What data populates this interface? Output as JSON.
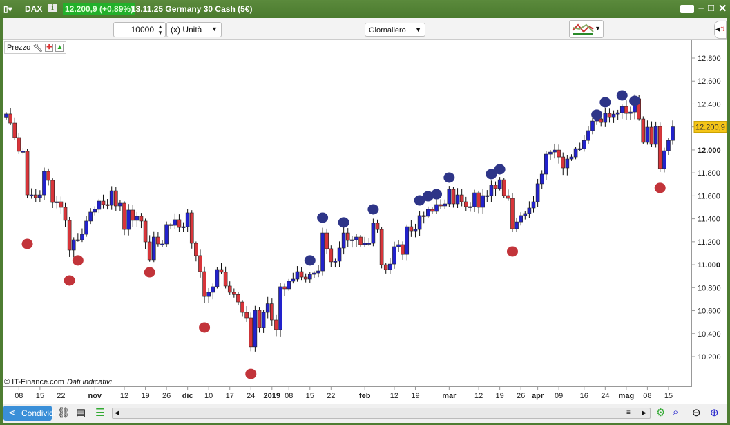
{
  "titlebar": {
    "symbol": "DAX",
    "last_price": "12.200,9 (+0,89%)",
    "description": "13.11.25 Germany 30 Cash (5€)",
    "info_icon": "i"
  },
  "toolbar": {
    "quantity": "10000",
    "unit": "(x) Unità",
    "timeframe": "Giornaliero"
  },
  "panel": {
    "legend_label": "Prezzo",
    "copyright": "© IT-Finance.com",
    "disclaimer": "Dati indicativi"
  },
  "bottombar": {
    "share_label": "Condividi"
  },
  "colors": {
    "up": "#2222cc",
    "down": "#d8353a",
    "marker_low": "#c2343a",
    "marker_high": "#2e3588",
    "last_price_bg": "#f5c518",
    "titlebar": "#4e7d32"
  },
  "chart_data": {
    "type": "candlestick",
    "y_ticks": [
      "12.800",
      "12.600",
      "12.400",
      "12.200",
      "12.000",
      "11.800",
      "11.600",
      "11.400",
      "11.200",
      "11.000",
      "10.800",
      "10.600",
      "10.400",
      "10.200"
    ],
    "y_tick_values": [
      12800,
      12600,
      12400,
      12200,
      12000,
      11800,
      11600,
      11400,
      11200,
      11000,
      10800,
      10600,
      10400,
      10200
    ],
    "bold_ticks": [
      "12.000",
      "11.000"
    ],
    "ylim": [
      10050,
      12950
    ],
    "last_price_label": "12.200,9",
    "last_price": 12200.9,
    "first_open": 12280,
    "closes": [
      12313,
      12234,
      12108,
      11988,
      11988,
      11608,
      11608,
      11584,
      11608,
      11813,
      11735,
      11542,
      11548,
      11500,
      11386,
      11127,
      11217,
      11217,
      11265,
      11380,
      11458,
      11482,
      11554,
      11524,
      11518,
      11644,
      11512,
      11536,
      11307,
      11476,
      11386,
      11422,
      11380,
      11199,
      11043,
      11241,
      11181,
      11181,
      11350,
      11343,
      11392,
      11325,
      11331,
      11452,
      11187,
      11079,
      10940,
      10723,
      10760,
      10808,
      10958,
      10935,
      10814,
      10760,
      10740,
      10675,
      10585,
      10537,
      10285,
      10603,
      10453,
      10585,
      10660,
      10519,
      10435,
      10808,
      10790,
      10856,
      10874,
      10940,
      10892,
      10874,
      10916,
      10928,
      10946,
      11277,
      11139,
      11025,
      11031,
      11145,
      11277,
      11211,
      11217,
      11241,
      11175,
      11187,
      11187,
      11362,
      11307,
      11000,
      10958,
      11006,
      11157,
      11175,
      11090,
      11331,
      11295,
      11307,
      11428,
      11422,
      11482,
      11464,
      11524,
      11512,
      11530,
      11656,
      11530,
      11608,
      11548,
      11506,
      11506,
      11626,
      11500,
      11602,
      11602,
      11693,
      11663,
      11740,
      11602,
      11578,
      11313,
      11373,
      11428,
      11446,
      11494,
      11548,
      11705,
      11789,
      11963,
      11981,
      11999,
      11939,
      11843,
      11921,
      11939,
      12011,
      12011,
      12083,
      12168,
      12252,
      12270,
      12240,
      12318,
      12282,
      12312,
      12324,
      12378,
      12318,
      12330,
      12445,
      12270,
      12066,
      12198,
      12048,
      12204,
      11837,
      11993,
      12083,
      12200.9
    ],
    "x_ticks": [
      {
        "label": "08",
        "index": 3
      },
      {
        "label": "15",
        "index": 8
      },
      {
        "label": "22",
        "index": 13
      },
      {
        "label": "nov",
        "index": 21,
        "bold": true
      },
      {
        "label": "12",
        "index": 28
      },
      {
        "label": "19",
        "index": 33
      },
      {
        "label": "26",
        "index": 38
      },
      {
        "label": "dic",
        "index": 43,
        "bold": true
      },
      {
        "label": "10",
        "index": 48
      },
      {
        "label": "17",
        "index": 53
      },
      {
        "label": "24",
        "index": 58
      },
      {
        "label": "2019",
        "index": 63,
        "bold": true
      },
      {
        "label": "08",
        "index": 67
      },
      {
        "label": "15",
        "index": 72
      },
      {
        "label": "22",
        "index": 77
      },
      {
        "label": "feb",
        "index": 85,
        "bold": true
      },
      {
        "label": "12",
        "index": 92
      },
      {
        "label": "19",
        "index": 97
      },
      {
        "label": "mar",
        "index": 105,
        "bold": true
      },
      {
        "label": "12",
        "index": 112
      },
      {
        "label": "19",
        "index": 117
      },
      {
        "label": "26",
        "index": 122
      },
      {
        "label": "apr",
        "index": 126,
        "bold": true
      },
      {
        "label": "09",
        "index": 131
      },
      {
        "label": "16",
        "index": 137
      },
      {
        "label": "24",
        "index": 142
      },
      {
        "label": "mag",
        "index": 147,
        "bold": true
      },
      {
        "label": "08",
        "index": 152
      },
      {
        "label": "15",
        "index": 157
      }
    ],
    "low_markers": [
      {
        "index": 5,
        "price": 11181
      },
      {
        "index": 15,
        "price": 10862
      },
      {
        "index": 17,
        "price": 11037
      },
      {
        "index": 34,
        "price": 10934
      },
      {
        "index": 47,
        "price": 10453
      },
      {
        "index": 58,
        "price": 10049
      },
      {
        "index": 120,
        "price": 11115
      },
      {
        "index": 155,
        "price": 11669
      }
    ],
    "high_markers": [
      {
        "index": 72,
        "price": 11037
      },
      {
        "index": 75,
        "price": 11410
      },
      {
        "index": 80,
        "price": 11368
      },
      {
        "index": 87,
        "price": 11482
      },
      {
        "index": 98,
        "price": 11560
      },
      {
        "index": 100,
        "price": 11596
      },
      {
        "index": 102,
        "price": 11614
      },
      {
        "index": 105,
        "price": 11759
      },
      {
        "index": 115,
        "price": 11789
      },
      {
        "index": 117,
        "price": 11831
      },
      {
        "index": 140,
        "price": 12307
      },
      {
        "index": 142,
        "price": 12415
      },
      {
        "index": 146,
        "price": 12475
      },
      {
        "index": 149,
        "price": 12427
      }
    ]
  }
}
